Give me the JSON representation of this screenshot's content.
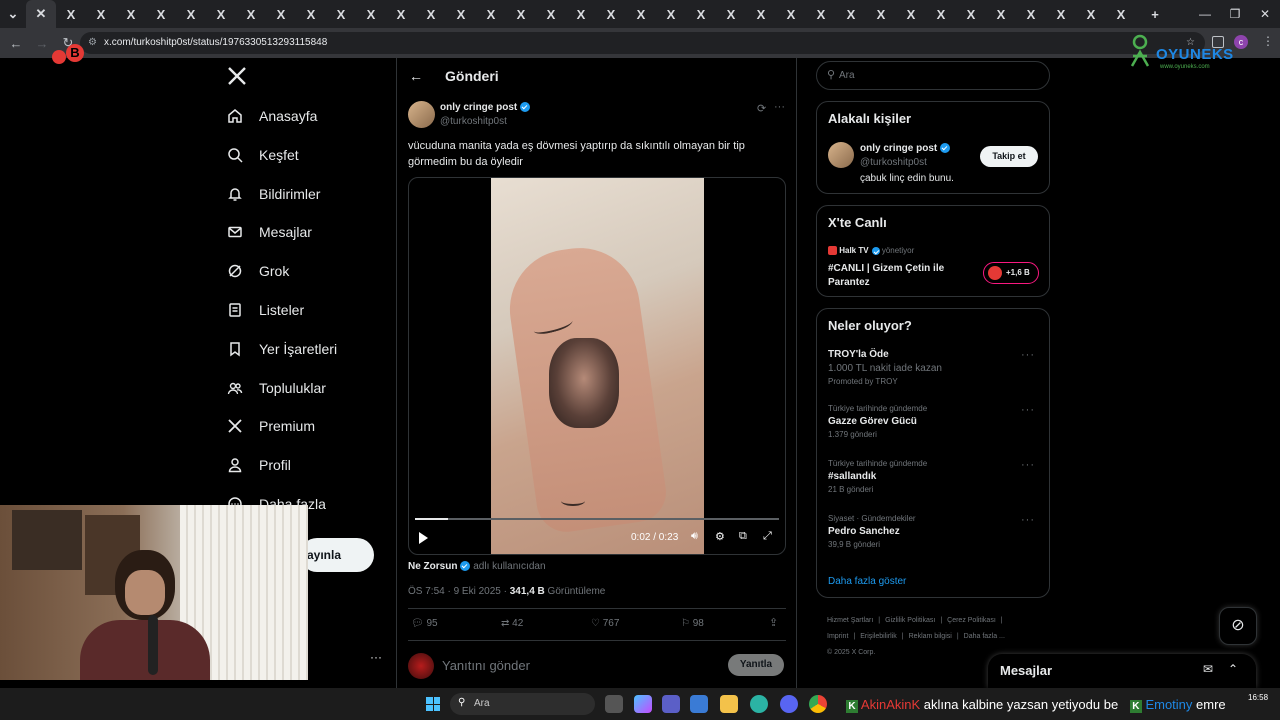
{
  "browser": {
    "url": "x.com/turkoshitp0st/status/1976330513293115848",
    "tab_count": 37,
    "logo_text": "OYUNEKS",
    "logo_subtext": "www.oyuneks.com"
  },
  "nav": {
    "items": [
      {
        "label": "Anasayfa",
        "icon": "home-icon"
      },
      {
        "label": "Keşfet",
        "icon": "search-icon"
      },
      {
        "label": "Bildirimler",
        "icon": "bell-icon"
      },
      {
        "label": "Mesajlar",
        "icon": "mail-icon"
      },
      {
        "label": "Grok",
        "icon": "grok-icon"
      },
      {
        "label": "Listeler",
        "icon": "list-icon"
      },
      {
        "label": "Yer İşaretleri",
        "icon": "bookmark-icon"
      },
      {
        "label": "Topluluklar",
        "icon": "communities-icon"
      },
      {
        "label": "Premium",
        "icon": "x-icon"
      },
      {
        "label": "Profil",
        "icon": "profile-icon"
      },
      {
        "label": "Daha fazla",
        "icon": "more-icon"
      }
    ],
    "post_button_partial": "ayınla",
    "account_more": "···"
  },
  "post": {
    "header_title": "Gönderi",
    "author_name": "only cringe post",
    "author_handle": "@turkoshitp0st",
    "text": "vücuduna manita yada eş dövmesi yaptırıp da sıkıntılı olmayan bir tip görmedim bu da öyledir",
    "video": {
      "time": "0:02 / 0:23",
      "progress": 0.09
    },
    "tagged_name": "Ne Zorsun",
    "tagged_suffix": "adlı kullanıcıdan",
    "timestamp": "ÖS 7:54 · 9 Eki 2025 ·",
    "views_count": "341,4 B",
    "views_label": "Görüntüleme",
    "stats": {
      "replies": "95",
      "reposts": "42",
      "likes": "767",
      "bookmarks": "98"
    },
    "reply_placeholder": "Yanıtını gönder",
    "reply_button": "Yanıtla"
  },
  "right": {
    "search_placeholder": "Ara",
    "related_title": "Alakalı kişiler",
    "related": {
      "name": "only cringe post",
      "handle": "@turkoshitp0st",
      "bio": "çabuk linç edin bunu.",
      "follow": "Takip et"
    },
    "live_title": "X'te Canlı",
    "live": {
      "host": "Halk TV",
      "host_suffix": "yönetiyor",
      "title": "#CANLI | Gizem Çetin ile Parantez",
      "listeners": "+1,6 B"
    },
    "trends_title": "Neler oluyor?",
    "trends": [
      {
        "context": "",
        "title": "TROY'la Öde",
        "sub": "1.000 TL nakit iade kazan",
        "meta": "Promoted by TROY"
      },
      {
        "context": "Türkiye tarihinde gündemde",
        "title": "Gazze Görev Gücü",
        "sub": "",
        "meta": "1.379 gönderi"
      },
      {
        "context": "Türkiye tarihinde gündemde",
        "title": "#sallandık",
        "sub": "",
        "meta": "21 B gönderi"
      },
      {
        "context": "Siyaset · Gündemdekiler",
        "title": "Pedro Sanchez",
        "sub": "",
        "meta": "39,9 B gönderi"
      }
    ],
    "show_more": "Daha fazla göster",
    "footer": {
      "line1": [
        "Hizmet Şartları",
        "|",
        "Gizlilik Politikası",
        "|",
        "Çerez Politikası",
        "|"
      ],
      "line2": [
        "Imprint",
        "|",
        "Erişilebilirlik",
        "|",
        "Reklam bilgisi",
        "|",
        "Daha fazla ..."
      ],
      "copyright": "© 2025 X Corp."
    }
  },
  "messages_drawer": {
    "title": "Mesajlar"
  },
  "taskbar": {
    "search": "Ara",
    "chat_user": "AkinAkinK",
    "chat_text": "aklına kalbine yazsan yetiyodu be",
    "chat_user2": "Emotiny",
    "chat_text2": "emre",
    "time": "16:58"
  },
  "colors": {
    "accent": "#1d9bf0",
    "background": "#000000",
    "border": "#2f3336",
    "muted": "#71767b",
    "live": "#f91880"
  }
}
